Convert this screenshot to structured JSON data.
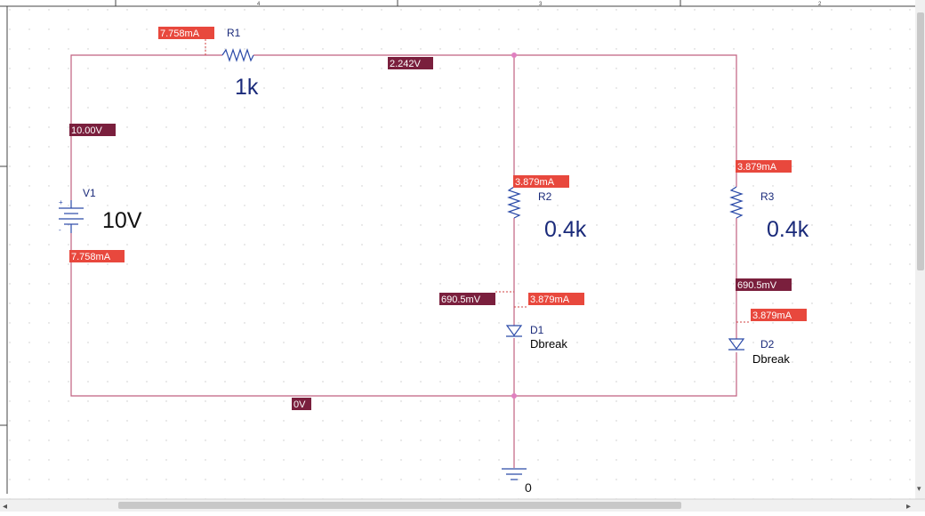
{
  "colors": {
    "wire": "#c06080",
    "component": "#2b4aa8",
    "current_badge": "#e8483d",
    "voltage_badge": "#7a1f3d",
    "text_blue": "#1a2a7a"
  },
  "ruler": {
    "zone_labels": [
      "4",
      "3",
      "2"
    ]
  },
  "v1": {
    "ref": "V1",
    "value": "10V",
    "plus": "+",
    "minus": "-"
  },
  "r1": {
    "ref": "R1",
    "value": "1k"
  },
  "r2": {
    "ref": "R2",
    "value": "0.4k"
  },
  "r3": {
    "ref": "R3",
    "value": "0.4k"
  },
  "d1": {
    "ref": "D1",
    "model": "Dbreak"
  },
  "d2": {
    "ref": "D2",
    "model": "Dbreak"
  },
  "ground": {
    "label": "0"
  },
  "probes": {
    "i_r1": "7.758mA",
    "v_node_top": "2.242V",
    "v_source": "10.00V",
    "i_v1": "7.758mA",
    "i_r2": "3.879mA",
    "i_r3": "3.879mA",
    "v_d1": "690.5mV",
    "i_d1": "3.879mA",
    "v_d2": "690.5mV",
    "i_d2": "3.879mA",
    "v_ground": "0V"
  },
  "scrollbar": {
    "left_arrow": "◂",
    "right_arrow": "▸",
    "up_arrow": "▴",
    "down_arrow": "▾"
  }
}
